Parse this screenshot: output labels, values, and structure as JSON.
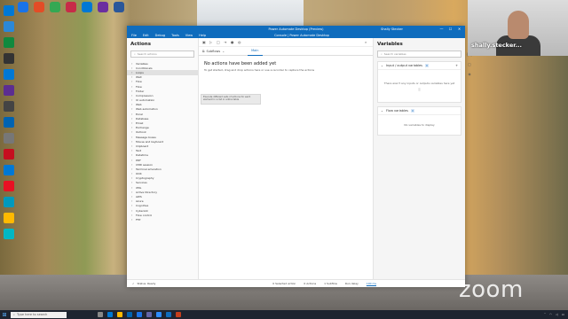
{
  "window": {
    "title": "Power Automate Desktop (Preview)",
    "user": "Shally Stecker",
    "minimize": "—",
    "maximize": "☐",
    "close": "✕"
  },
  "menu": [
    "File",
    "Edit",
    "Debug",
    "Tools",
    "View",
    "Help"
  ],
  "subtitle": "Console | Power Automate Desktop",
  "actions_panel": {
    "title": "Actions",
    "search_placeholder": "Search actions",
    "items": [
      "Variables",
      "Conditionals",
      "Loops",
      "Wait",
      "Flow",
      "Flow",
      "Folder",
      "Compression",
      "UI automation",
      "Web",
      "Web automation",
      "Excel",
      "Database",
      "Email",
      "Exchange",
      "Outlook",
      "Message boxes",
      "Mouse and keyboard",
      "Clipboard",
      "Text",
      "Datetime",
      "PDF",
      "CMD session",
      "Terminal emulation",
      "OCR",
      "Cryptography",
      "Services",
      "XML",
      "Active Directory",
      "AWS",
      "Azure",
      "Cognitive",
      "CyberArk",
      "Flow control",
      "FTP"
    ],
    "hover_index": 2
  },
  "toolbar": {
    "subflows_label": "Subflows",
    "main_tab": "Main"
  },
  "main": {
    "empty_title": "No actions have been added yet",
    "empty_subtitle": "To get started, drag and drop actions here or use a recorder to capture the actions",
    "tooltip": "Execute different sets of actions for each element in a list or entire table"
  },
  "variables_panel": {
    "title": "Variables",
    "search_placeholder": "Search variables",
    "io_title": "Input / output variables",
    "io_count": "0",
    "io_empty": "There aren't any inputs or outputs variables here yet",
    "flow_title": "Flow variables",
    "flow_count": "0",
    "flow_empty": "No variables to display"
  },
  "status": {
    "left": "Status: Ready",
    "selected": "0 Selected action",
    "actions": "0 Actions",
    "subflow": "1 Subflow",
    "delay_label": "Run delay",
    "delay_value": "100 ms"
  },
  "zoom": {
    "participant_name": "shally.stecker...",
    "logo": "zoom"
  },
  "taskbar": {
    "search_placeholder": "Type here to search"
  }
}
